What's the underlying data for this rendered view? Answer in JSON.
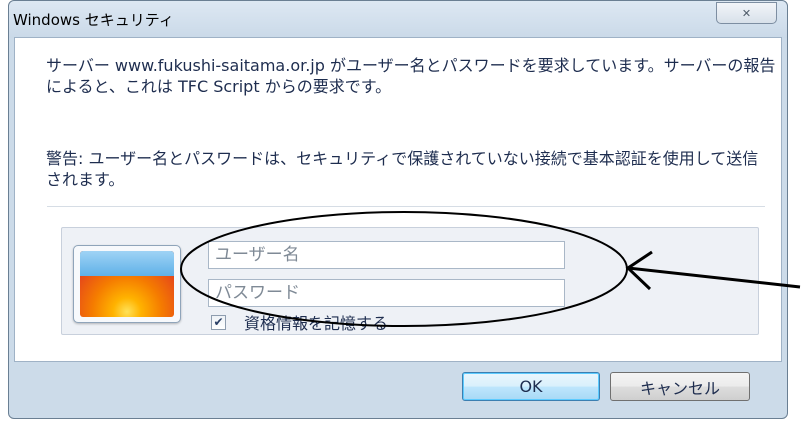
{
  "window": {
    "title": "Windows セキュリティ",
    "close_icon": "close-icon"
  },
  "message": {
    "line1": "サーバー www.fukushi-saitama.or.jp がユーザー名とパスワードを要求しています。サーバーの報告によると、これは TFC Script からの要求です。",
    "warning": "警告: ユーザー名とパスワードは、セキュリティで保護されていない接続で基本認証を使用して送信されます。"
  },
  "credentials": {
    "username_placeholder": "ユーザー名",
    "password_placeholder": "パスワード",
    "remember_label": "資格情報を記憶する",
    "remember_checked": true
  },
  "buttons": {
    "ok": "OK",
    "cancel": "キャンセル"
  },
  "annotation": {
    "color": "#000000"
  }
}
